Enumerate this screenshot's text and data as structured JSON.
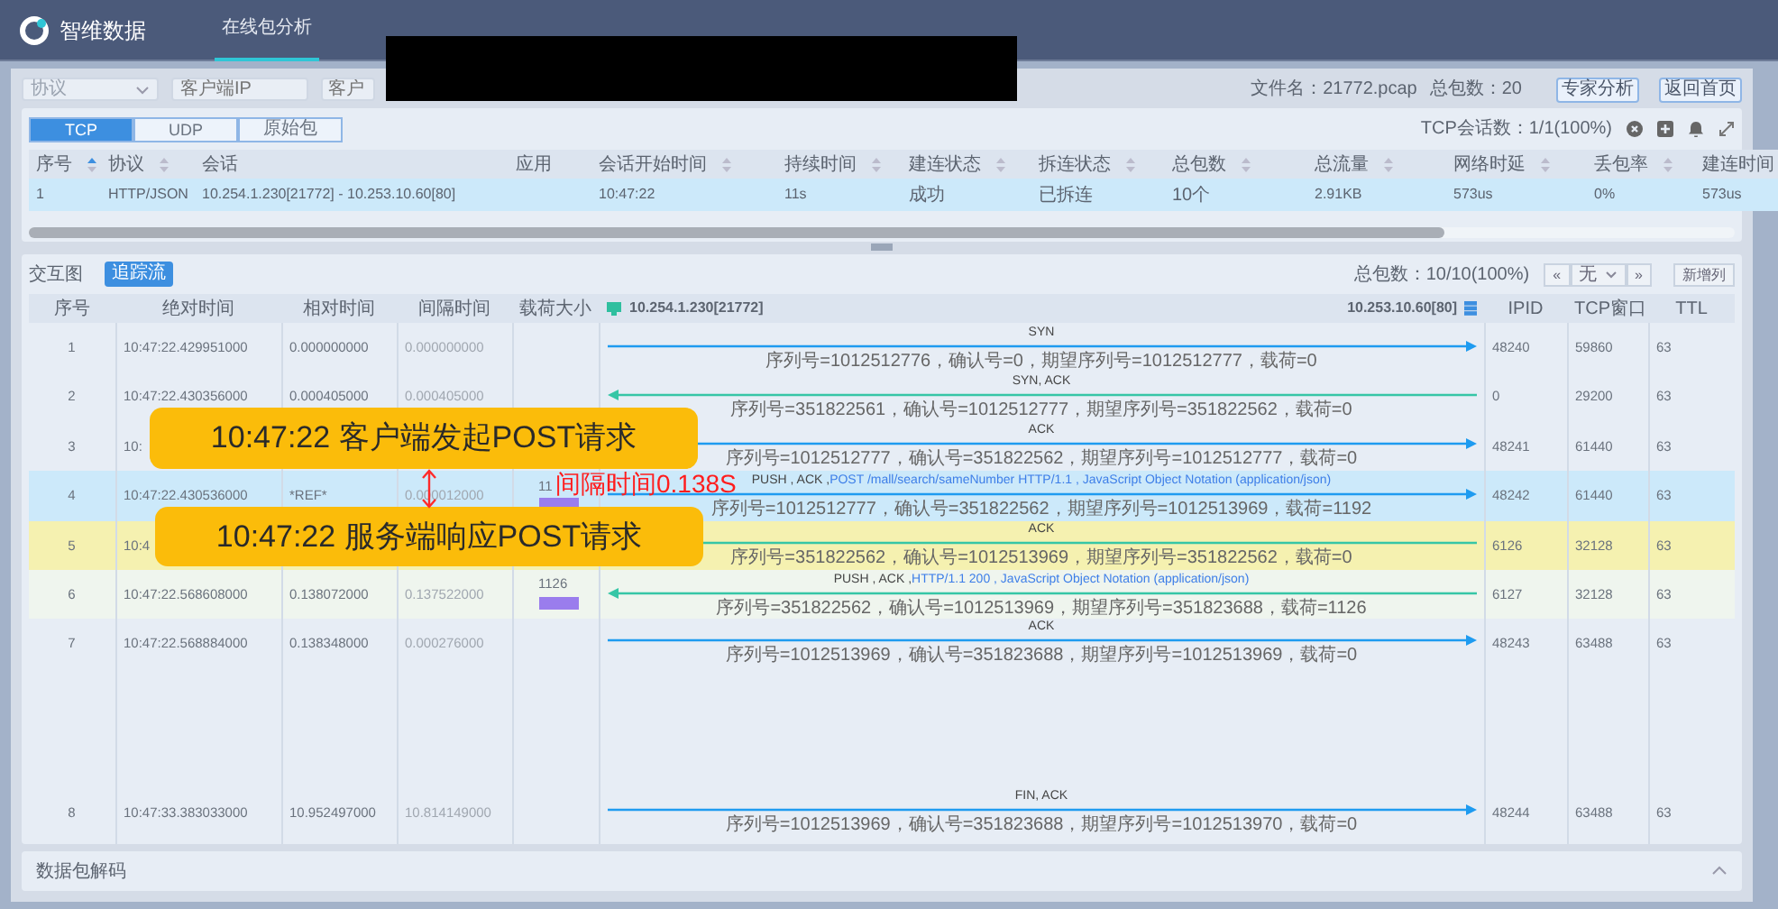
{
  "header": {
    "brand": "智维数据",
    "nav": [
      {
        "label": "在线包分析",
        "selected": true
      }
    ]
  },
  "filters": {
    "protocol": {
      "placeholder": "协议"
    },
    "client_ip": {
      "placeholder": "客户端IP"
    },
    "field_3": {
      "placeholder": "客户"
    },
    "redacted": true,
    "file_label": "文件名：21772.pcap",
    "total_label": "总包数：20",
    "buttons": [
      "专家分析",
      "返回首页"
    ]
  },
  "sessions": {
    "tabs": [
      {
        "label": "TCP",
        "selected": true
      },
      {
        "label": "UDP",
        "selected": false
      },
      {
        "label": "原始包",
        "selected": false
      }
    ],
    "count": "TCP会话数：1/1(100%)",
    "columns": [
      {
        "label": "序号",
        "sortable": true,
        "sorted": true
      },
      {
        "label": "协议",
        "sortable": true,
        "sorted": false
      },
      {
        "label": "会话",
        "sortable": false
      },
      {
        "label": "应用",
        "sortable": false
      },
      {
        "label": "会话开始时间",
        "sortable": true,
        "sorted": false
      },
      {
        "label": "持续时间",
        "sortable": true,
        "sorted": false
      },
      {
        "label": "建连状态",
        "sortable": true,
        "sorted": false
      },
      {
        "label": "拆连状态",
        "sortable": true,
        "sorted": false
      },
      {
        "label": "总包数",
        "sortable": true,
        "sorted": false
      },
      {
        "label": "总流量",
        "sortable": true,
        "sorted": false
      },
      {
        "label": "网络时延",
        "sortable": true,
        "sorted": false
      },
      {
        "label": "丢包率",
        "sortable": true,
        "sorted": false
      },
      {
        "label": "建连时间",
        "sortable": false
      }
    ],
    "rows": [
      {
        "selected": true,
        "cells": [
          "1",
          "HTTP/JSON",
          "10.254.1.230[21772] - 10.253.10.60[80]",
          null,
          "10:47:22",
          "11s",
          "成功",
          "已拆连",
          "10个",
          "2.91KB",
          "573us",
          "0%",
          "573us"
        ]
      }
    ]
  },
  "flow": {
    "title": "交互图",
    "button": "追踪流",
    "count": "总包数：10/10(100%)",
    "pager": {
      "prev": "«",
      "value": "无",
      "next": "»"
    },
    "add_column": "新增列",
    "columns": [
      "序号",
      "绝对时间",
      "相对时间",
      "间隔时间",
      "载荷大小"
    ],
    "client": "10.254.1.230[21772]",
    "server": "10.253.10.60[80]",
    "extra_columns": [
      "IPID",
      "TCP窗口",
      "TTL"
    ],
    "packets": [
      {
        "no": "1",
        "abs": "10:47:22.429951000",
        "rel": "0.000000000",
        "gap": "0.000000000",
        "kind": "request",
        "flags": "SYN",
        "detail": "序列号=1012512776，确认号=0，期望序列号=1012512777，载荷=0",
        "ipid": "48240",
        "window": "59860",
        "ttl": "63"
      },
      {
        "no": "2",
        "abs": "10:47:22.430356000",
        "rel": "0.000405000",
        "gap": "0.000405000",
        "kind": "response",
        "flags": "SYN, ACK",
        "detail": "序列号=351822561，确认号=1012512777，期望序列号=351822562，载荷=0",
        "ipid": "0",
        "window": "29200",
        "ttl": "63"
      },
      {
        "no": "3",
        "abs": "10:",
        "kind": "request",
        "flags": "ACK",
        "detail": "序列号=1012512777，确认号=351822562，期望序列号=1012512777，载荷=0",
        "ipid": "48241",
        "window": "61440",
        "ttl": "63"
      },
      {
        "no": "4",
        "abs": "10:47:22.430536000",
        "rel": "*REF*",
        "gap": "0.000012000",
        "payload": "11",
        "kind": "request",
        "flags": "PUSH , ACK ,",
        "info": "POST /mall/search/sameNumber HTTP/1.1 , JavaScript Object Notation (application/json)",
        "detail": "序列号=1012512777，确认号=351822562，期望序列号=1012513969，载荷=1192",
        "ipid": "48242",
        "window": "61440",
        "ttl": "63",
        "color": "#cce9fa"
      },
      {
        "no": "5",
        "abs": "10:4",
        "kind": "response",
        "flags": "ACK",
        "detail": "序列号=351822562，确认号=1012513969，期望序列号=351822562，载荷=0",
        "ipid": "6126",
        "window": "32128",
        "ttl": "63",
        "color": "#f5f1b0"
      },
      {
        "no": "6",
        "abs": "10:47:22.568608000",
        "rel": "0.138072000",
        "gap": "0.137522000",
        "payload": "1126",
        "kind": "response",
        "flags": "PUSH , ACK ,",
        "info": "HTTP/1.1 200 , JavaScript Object Notation (application/json)",
        "detail": "序列号=351822562，确认号=1012513969，期望序列号=351823688，载荷=1126",
        "ipid": "6127",
        "window": "32128",
        "ttl": "63",
        "color": "#eff5ee"
      },
      {
        "no": "7",
        "abs": "10:47:22.568884000",
        "rel": "0.138348000",
        "gap": "0.000276000",
        "kind": "request",
        "flags": "ACK",
        "detail": "序列号=1012513969，确认号=351823688，期望序列号=1012513969，载荷=0",
        "ipid": "48243",
        "window": "63488",
        "ttl": "63"
      },
      {
        "no": "8",
        "abs": "10:47:33.383033000",
        "rel": "10.952497000",
        "gap": "10.814149000",
        "kind": "request",
        "flags": "FIN, ACK",
        "detail": "序列号=1012513969，确认号=351823688，期望序列号=1012513970，载荷=0",
        "ipid": "48244",
        "window": "63488",
        "ttl": "63"
      }
    ]
  },
  "decode": {
    "title": "数据包解码",
    "expanded": false
  },
  "annotations": [
    {
      "kind": "callout",
      "text": "10:47:22 客户端发起POST请求"
    },
    {
      "kind": "callout",
      "text": "10:47:22 服务端响应POST请求"
    },
    {
      "kind": "gap",
      "text": "间隔时间0.138S"
    }
  ]
}
